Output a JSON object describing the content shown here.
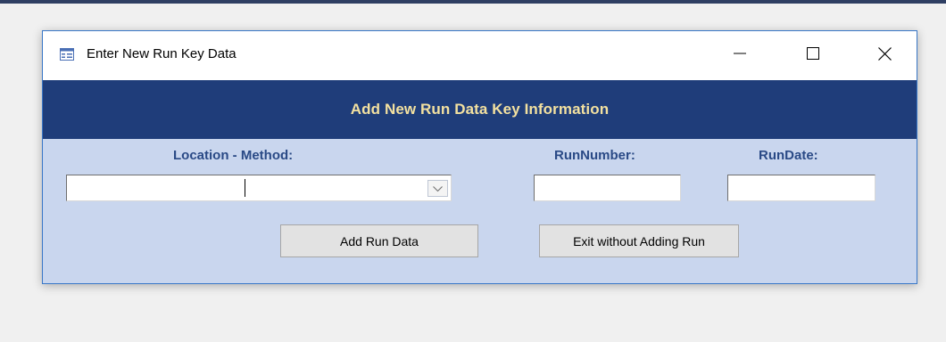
{
  "window": {
    "title": "Enter New Run Key Data",
    "icon": "form-icon"
  },
  "titlebar": {
    "minimize_icon": "minimize-icon",
    "maximize_icon": "maximize-icon",
    "close_icon": "close-icon"
  },
  "header": {
    "title": "Add New Run Data Key Information"
  },
  "fields": {
    "location_method": {
      "label": "Location - Method:",
      "value": ""
    },
    "run_number": {
      "label": "RunNumber:",
      "value": ""
    },
    "run_date": {
      "label": "RunDate:",
      "value": ""
    }
  },
  "buttons": {
    "add_run": "Add Run Data",
    "exit": "Exit without Adding Run"
  },
  "colors": {
    "header_band": "#1f3d7a",
    "header_text": "#f3e1a0",
    "form_background": "#c9d6ee",
    "label_text": "#2a4a86",
    "window_border": "#3a78c7"
  }
}
